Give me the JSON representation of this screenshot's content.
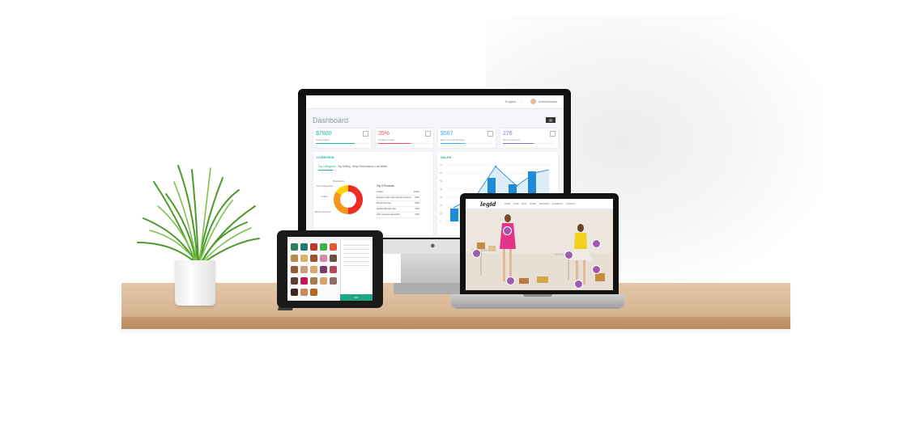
{
  "colors": {
    "teal": "#1bb99a",
    "red": "#f05050",
    "blue": "#3ea7ef",
    "purple": "#8a6cd1",
    "chart_blue": "#1f8bd6",
    "donut_orange": "#f7941d",
    "donut_yellow": "#ffd200",
    "donut_red": "#ef2b24"
  },
  "dashboard": {
    "title": "Dashboard",
    "topbar": {
      "language": "English",
      "user": "Administrator"
    },
    "stats": [
      {
        "value": "$7800",
        "label": "Today Sales",
        "color": "#1bb99a"
      },
      {
        "value": "35%",
        "label": "Update Growth",
        "color": "#f05050"
      },
      {
        "value": "$567",
        "label": "Expense Last 30 Days",
        "color": "#3ea7ef"
      },
      {
        "value": "276",
        "label": "New Customers",
        "color": "#8a6cd1"
      }
    ],
    "overview": {
      "title": "OVERVIEW",
      "tabs": [
        "Top Categories",
        "Top Selling",
        "Shop Performance",
        "Last Week"
      ],
      "donut_labels": [
        "Top Categories",
        "Coffee",
        "Bestsellers",
        "Books Woman"
      ],
      "top_products": {
        "title": "Top 5 Products",
        "rows": [
          {
            "name": "Coffee",
            "pct": "100%"
          },
          {
            "name": "Regular Latte with special caramel",
            "pct": "85%"
          },
          {
            "name": "Books Woman",
            "pct": "55%"
          },
          {
            "name": "Herbal Woman Tea",
            "pct": "45%"
          },
          {
            "name": "Kids Crumbs Sandwich",
            "pct": "30%"
          }
        ]
      }
    },
    "sales": {
      "title": "SALES",
      "y_ticks": [
        "70",
        "60",
        "50",
        "40",
        "30",
        "20",
        "10",
        "0"
      ]
    }
  },
  "pos": {
    "pay_label": "PAY"
  },
  "shop": {
    "logo": "legid",
    "nav": [
      "HOME",
      "SHOP",
      "BLOG",
      "PAGES",
      "FEATURES",
      "ELEMENTS",
      "CONTACT"
    ]
  }
}
